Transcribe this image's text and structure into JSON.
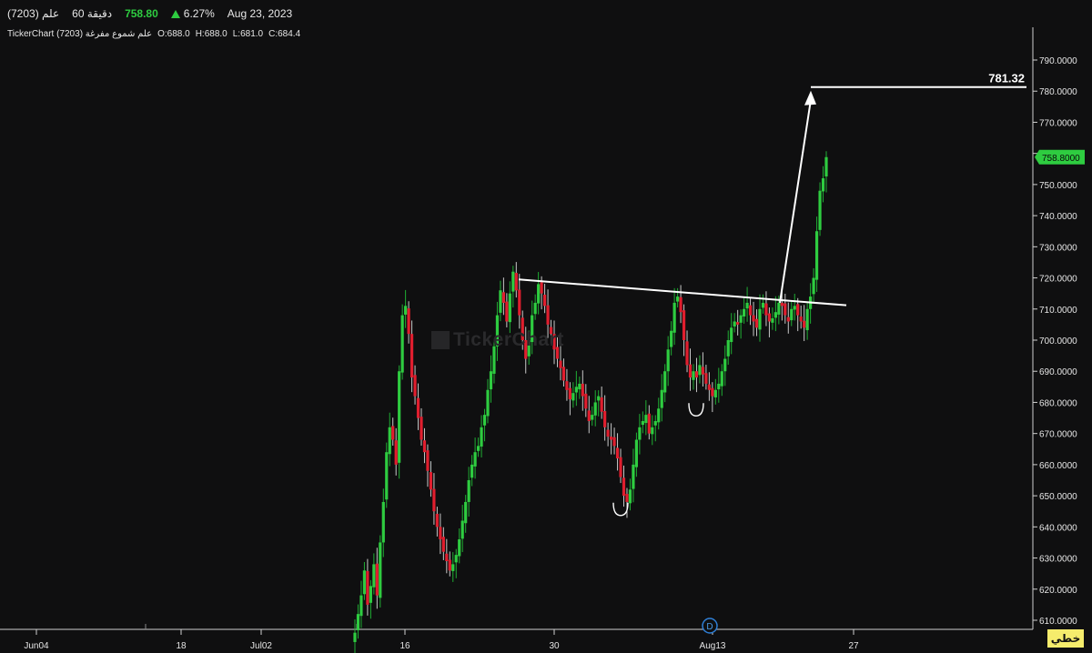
{
  "header": {
    "symbol": "(7203) علم",
    "timeframe": "60 دقيقة",
    "price": "758.80",
    "change": "6.27%",
    "date": "Aug 23, 2023"
  },
  "subheader": {
    "label": "TickerChart علم شموع مفرغة (7203)",
    "open": "O:688.0",
    "high": "H:688.0",
    "low": "L:681.0",
    "close": "C:684.4"
  },
  "watermark": "TickerChart",
  "target_label": "781.32",
  "price_badge": "758.8000",
  "event_marker": "D",
  "line_button": "خطي",
  "colors": {
    "background": "#0f0f10",
    "up": "#2ecc40",
    "down": "#e01e2e",
    "wick_up": "#1fae33",
    "wick_down": "#c8c8c8",
    "annotation": "#ffffff",
    "badge": "#2ecc40"
  },
  "chart_data": {
    "type": "candlestick",
    "x_tick_labels": [
      "Jun04",
      "18",
      "Jul02",
      "16",
      "30",
      "Aug13",
      "27"
    ],
    "y_tick_labels": [
      "610.0000",
      "620.0000",
      "630.0000",
      "640.0000",
      "650.0000",
      "660.0000",
      "670.0000",
      "680.0000",
      "690.0000",
      "700.0000",
      "710.0000",
      "720.0000",
      "730.0000",
      "740.0000",
      "750.0000",
      "760.0000",
      "770.0000",
      "780.0000",
      "790.0000"
    ],
    "ylim": [
      606,
      796
    ],
    "last_price": 758.8,
    "target": 781.32,
    "neckline": [
      [
        0,
        719.5
      ],
      [
        1,
        711.2
      ]
    ],
    "trough_markers": [
      646,
      678
    ],
    "closes": [
      606,
      612,
      618,
      626,
      615,
      621,
      628,
      618,
      635,
      648,
      664,
      672,
      668,
      660,
      690,
      708,
      711,
      702,
      688,
      682,
      675,
      668,
      664,
      658,
      652,
      645,
      640,
      636,
      632,
      629,
      626,
      628,
      631,
      636,
      642,
      648,
      655,
      660,
      664,
      666,
      672,
      676,
      684,
      690,
      698,
      708,
      716,
      712,
      706,
      715,
      722,
      716,
      708,
      700,
      694,
      700,
      708,
      712,
      718,
      715,
      711,
      705,
      702,
      697,
      694,
      691,
      687,
      684,
      681,
      683,
      685,
      686,
      682,
      678,
      674,
      676,
      680,
      682,
      677,
      672,
      669,
      668,
      666,
      662,
      656,
      650,
      648,
      652,
      660,
      668,
      672,
      674,
      676,
      670,
      672,
      674,
      678,
      684,
      690,
      697,
      703,
      712,
      714,
      709,
      700,
      692,
      688,
      690,
      688,
      692,
      689,
      686,
      684,
      682,
      684,
      686,
      690,
      694,
      700,
      704,
      706,
      705,
      708,
      710,
      712,
      708,
      706,
      704,
      710,
      712,
      708,
      706,
      707,
      709,
      712,
      711,
      708,
      706,
      710,
      711,
      708,
      706,
      704,
      710,
      714,
      720,
      735,
      748,
      752,
      758.8
    ]
  }
}
